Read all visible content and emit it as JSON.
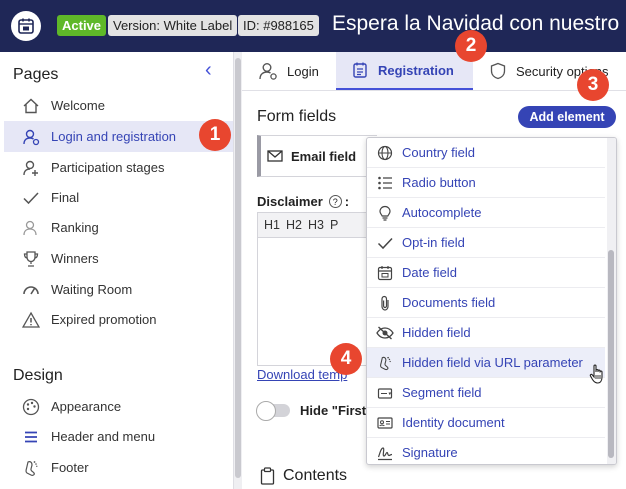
{
  "header": {
    "status_badge": "Active",
    "version_badge": "Version: White Label",
    "id_badge": "ID: #988165",
    "title": "Espera la Navidad con nuestro"
  },
  "sidebar": {
    "pages_title": "Pages",
    "pages": [
      {
        "label": "Welcome",
        "icon": "home-icon"
      },
      {
        "label": "Login and registration",
        "icon": "user-login-icon",
        "active": true
      },
      {
        "label": "Participation stages",
        "icon": "user-add-icon"
      },
      {
        "label": "Final",
        "icon": "check-icon"
      },
      {
        "label": "Ranking",
        "icon": "ranking-icon"
      },
      {
        "label": "Winners",
        "icon": "trophy-icon"
      },
      {
        "label": "Waiting Room",
        "icon": "gauge-icon"
      },
      {
        "label": "Expired promotion",
        "icon": "warning-icon"
      }
    ],
    "design_title": "Design",
    "design": [
      {
        "label": "Appearance",
        "icon": "palette-icon"
      },
      {
        "label": "Header and menu",
        "icon": "menu-icon"
      },
      {
        "label": "Footer",
        "icon": "foot-icon"
      }
    ]
  },
  "tabs": [
    {
      "label": "Login",
      "icon": "user-icon"
    },
    {
      "label": "Registration",
      "icon": "form-icon",
      "active": true
    },
    {
      "label": "Security options",
      "icon": "shield-icon"
    }
  ],
  "main": {
    "form_fields_title": "Form fields",
    "add_element_label": "Add element",
    "email_field_label": "Email field",
    "disclaimer_label": "Disclaimer",
    "help_glyph": "?",
    "disclaimer_colon": ":",
    "editor_toolbar": [
      "H1",
      "H2",
      "H3",
      "P"
    ],
    "download_link": "Download temp",
    "toggle_label": "Hide \"First",
    "contents_title": "Contents"
  },
  "dropdown": {
    "items": [
      {
        "label": "Country field",
        "icon": "globe-icon"
      },
      {
        "label": "Radio button",
        "icon": "radio-list-icon"
      },
      {
        "label": "Autocomplete",
        "icon": "bulb-icon"
      },
      {
        "label": "Opt-in field",
        "icon": "checkmark-icon"
      },
      {
        "label": "Date field",
        "icon": "calendar-icon"
      },
      {
        "label": "Documents field",
        "icon": "paperclip-icon"
      },
      {
        "label": "Hidden field",
        "icon": "eye-slash-icon"
      },
      {
        "label": "Hidden field via URL parameter",
        "icon": "foot-icon",
        "hover": true
      },
      {
        "label": "Segment field",
        "icon": "segment-icon"
      },
      {
        "label": "Identity document",
        "icon": "id-card-icon"
      },
      {
        "label": "Signature",
        "icon": "signature-icon"
      }
    ]
  },
  "steps": [
    "1",
    "2",
    "3",
    "4"
  ],
  "colors": {
    "header_bg": "#1f2757",
    "accent": "#3544b5",
    "active_bg": "#e6e7f6",
    "badge_green": "#5fb829",
    "step_red": "#e8462f"
  }
}
